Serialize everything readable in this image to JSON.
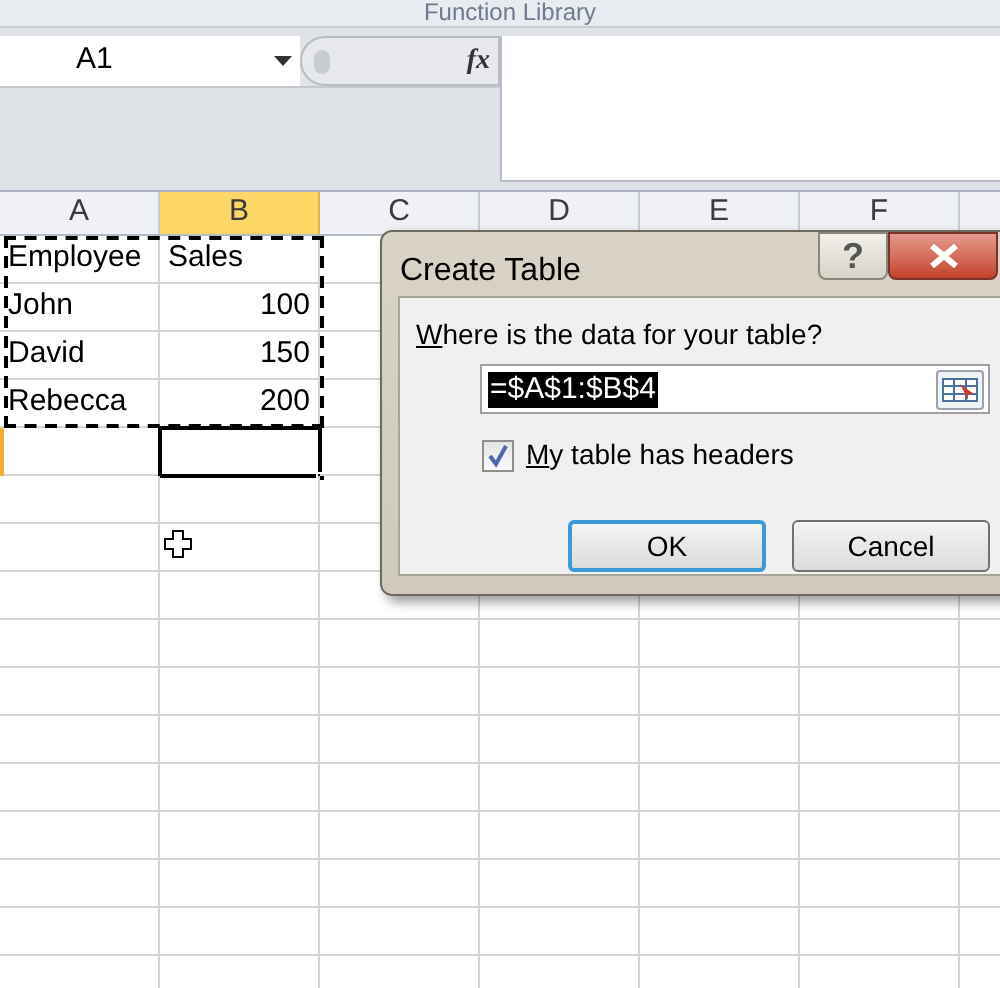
{
  "ribbon": {
    "group_label": "Function Library"
  },
  "formula_bar": {
    "name_box": "A1",
    "function_button": "fx"
  },
  "columns": [
    {
      "label": "A",
      "selected": false
    },
    {
      "label": "B",
      "selected": true
    },
    {
      "label": "C",
      "selected": false
    },
    {
      "label": "D",
      "selected": false
    },
    {
      "label": "E",
      "selected": false
    },
    {
      "label": "F",
      "selected": false
    }
  ],
  "range_marquee": true,
  "rows": [
    {
      "cells": [
        {
          "kind": "text",
          "text": "Employee",
          "selected": false
        },
        {
          "kind": "text",
          "text": "Sales",
          "selected": false
        }
      ]
    },
    {
      "cells": [
        {
          "kind": "text",
          "text": "John",
          "selected": false
        },
        {
          "kind": "number",
          "text": "100",
          "selected": false
        }
      ]
    },
    {
      "cells": [
        {
          "kind": "text",
          "text": "David",
          "selected": false
        },
        {
          "kind": "number",
          "text": "150",
          "selected": false
        }
      ]
    },
    {
      "cells": [
        {
          "kind": "text",
          "text": "Rebecca",
          "selected": false
        },
        {
          "kind": "number",
          "text": "200",
          "selected": false
        }
      ]
    },
    {
      "cells": [
        {
          "kind": "empty",
          "selected": false
        },
        {
          "kind": "empty",
          "selected": true
        }
      ]
    }
  ],
  "dialog": {
    "title": "Create Table",
    "help_button": "?",
    "prompt": "Where is the data for your table?",
    "range": "=$A$1:$B$4",
    "range_selected": true,
    "headers_checkbox": {
      "label": "My table has headers",
      "checked": true
    },
    "buttons": [
      {
        "label": "OK",
        "default": true
      },
      {
        "label": "Cancel",
        "default": false
      }
    ]
  }
}
